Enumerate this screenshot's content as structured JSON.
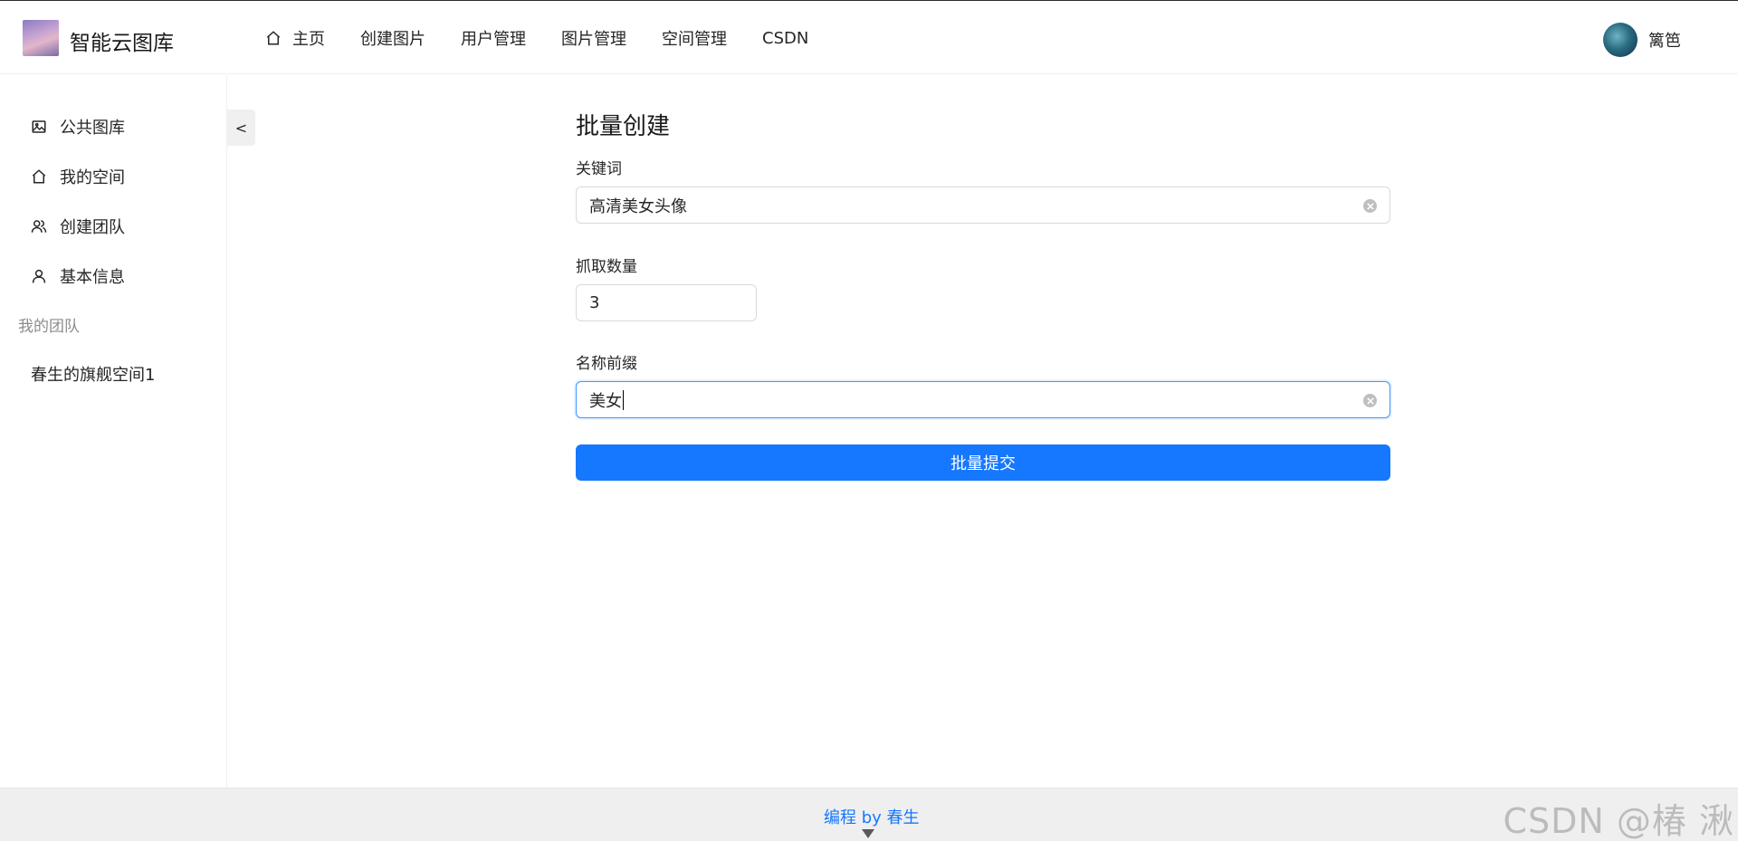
{
  "header": {
    "app_title": "智能云图库",
    "nav": [
      {
        "label": "主页",
        "icon": "home-icon"
      },
      {
        "label": "创建图片"
      },
      {
        "label": "用户管理"
      },
      {
        "label": "图片管理"
      },
      {
        "label": "空间管理"
      },
      {
        "label": "CSDN"
      }
    ],
    "user_name": "篱笆"
  },
  "sidebar": {
    "items": [
      {
        "label": "公共图库",
        "icon": "picture-icon"
      },
      {
        "label": "我的空间",
        "icon": "home-icon"
      },
      {
        "label": "创建团队",
        "icon": "team-icon"
      },
      {
        "label": "基本信息",
        "icon": "user-icon"
      }
    ],
    "group_title": "我的团队",
    "team_items": [
      {
        "label": "春生的旗舰空间1"
      }
    ],
    "collapse_label": "<"
  },
  "form": {
    "title": "批量创建",
    "keyword_label": "关键词",
    "keyword_value": "高清美女头像",
    "count_label": "抓取数量",
    "count_value": "3",
    "prefix_label": "名称前缀",
    "prefix_value": "美女",
    "submit_label": "批量提交"
  },
  "footer": {
    "link_text": "编程 by 春生"
  },
  "watermark": "CSDN @椿  湫",
  "colors": {
    "primary": "#1677ff",
    "focus_border": "#4096ff"
  }
}
